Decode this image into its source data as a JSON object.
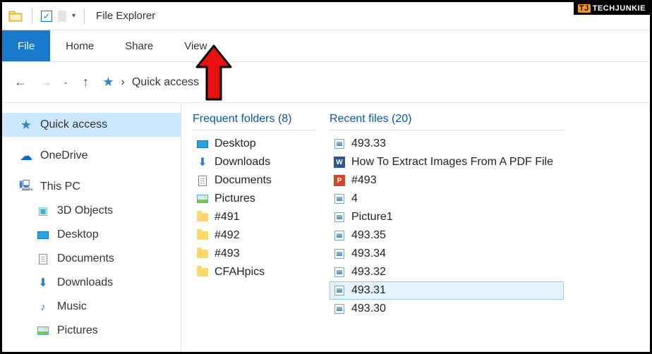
{
  "window": {
    "title": "File Explorer"
  },
  "ribbon": {
    "file": "File",
    "home": "Home",
    "share": "Share",
    "view": "View"
  },
  "address": {
    "location": "Quick access"
  },
  "sidebar": {
    "quick_access": "Quick access",
    "onedrive": "OneDrive",
    "this_pc": "This PC",
    "children": {
      "objects3d": "3D Objects",
      "desktop": "Desktop",
      "documents": "Documents",
      "downloads": "Downloads",
      "music": "Music",
      "pictures": "Pictures"
    }
  },
  "groups": {
    "frequent": {
      "title": "Frequent folders (8)"
    },
    "recent": {
      "title": "Recent files (20)"
    }
  },
  "frequent_folders": [
    {
      "icon": "desktop",
      "label": "Desktop"
    },
    {
      "icon": "download",
      "label": "Downloads"
    },
    {
      "icon": "document",
      "label": "Documents"
    },
    {
      "icon": "pictures",
      "label": "Pictures"
    },
    {
      "icon": "folder",
      "label": "#491"
    },
    {
      "icon": "folder",
      "label": "#492"
    },
    {
      "icon": "folder",
      "label": "#493"
    },
    {
      "icon": "folder",
      "label": "CFAHpics"
    }
  ],
  "recent_files": [
    {
      "icon": "image",
      "label": "493.33"
    },
    {
      "icon": "word",
      "label": "How To Extract Images From A PDF File"
    },
    {
      "icon": "ppt",
      "label": "#493"
    },
    {
      "icon": "image",
      "label": "4"
    },
    {
      "icon": "image",
      "label": "Picture1"
    },
    {
      "icon": "image",
      "label": "493.35"
    },
    {
      "icon": "image",
      "label": "493.34"
    },
    {
      "icon": "image",
      "label": "493.32"
    },
    {
      "icon": "image",
      "label": "493.31",
      "selected": true
    },
    {
      "icon": "image",
      "label": "493.30"
    }
  ],
  "watermark": {
    "badge": "TJ",
    "text": "TECHJUNKIE"
  }
}
